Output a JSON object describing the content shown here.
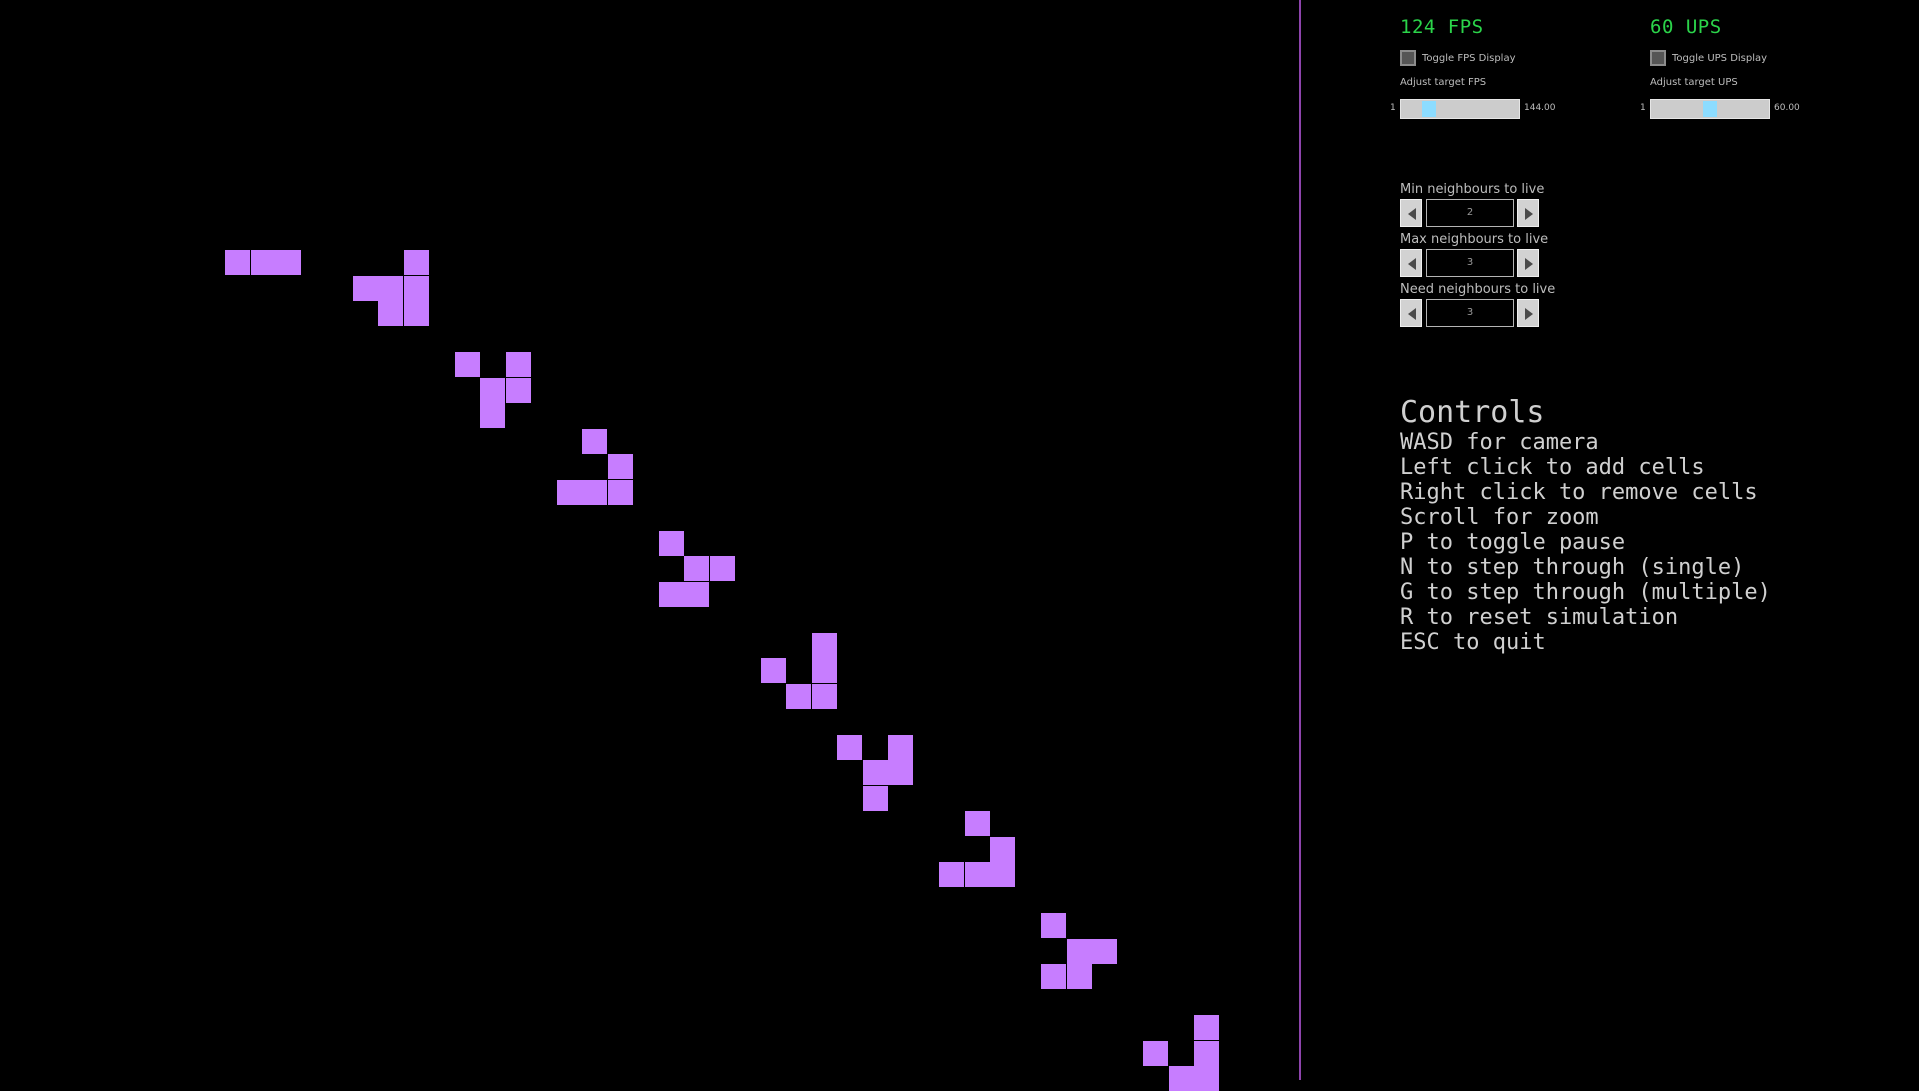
{
  "colors": {
    "background": "#000000",
    "cell": "#c77dff",
    "divider": "#8e44ad",
    "perf_text": "#2bd44a",
    "slider_handle": "#8cdcff"
  },
  "simulation": {
    "cells": [
      [
        0,
        0
      ],
      [
        1,
        0
      ],
      [
        2,
        0
      ],
      [
        7,
        0
      ],
      [
        5,
        1
      ],
      [
        6,
        1
      ],
      [
        7,
        1
      ],
      [
        6,
        2
      ],
      [
        7,
        2
      ],
      [
        9,
        4
      ],
      [
        11,
        4
      ],
      [
        10,
        5
      ],
      [
        11,
        5
      ],
      [
        10,
        6
      ],
      [
        14,
        7
      ],
      [
        15,
        8
      ],
      [
        13,
        9
      ],
      [
        14,
        9
      ],
      [
        15,
        9
      ],
      [
        17,
        11
      ],
      [
        18,
        12
      ],
      [
        19,
        12
      ],
      [
        17,
        13
      ],
      [
        18,
        13
      ],
      [
        23,
        15
      ],
      [
        21,
        16
      ],
      [
        23,
        16
      ],
      [
        22,
        17
      ],
      [
        23,
        17
      ],
      [
        24,
        19
      ],
      [
        26,
        19
      ],
      [
        25,
        20
      ],
      [
        26,
        20
      ],
      [
        25,
        21
      ],
      [
        29,
        22
      ],
      [
        30,
        23
      ],
      [
        28,
        24
      ],
      [
        29,
        24
      ],
      [
        30,
        24
      ],
      [
        32,
        26
      ],
      [
        33,
        27
      ],
      [
        34,
        27
      ],
      [
        32,
        28
      ],
      [
        33,
        28
      ],
      [
        38,
        30
      ],
      [
        36,
        31
      ],
      [
        38,
        31
      ],
      [
        37,
        32
      ],
      [
        38,
        32
      ]
    ]
  },
  "panel": {
    "fps": {
      "readout": "124 FPS",
      "toggle_label": "Toggle FPS Display",
      "adjust_label": "Adjust target FPS",
      "slider_min": "1",
      "slider_max": "144.00",
      "slider_fraction": 0.2
    },
    "ups": {
      "readout": "60 UPS",
      "toggle_label": "Toggle UPS Display",
      "adjust_label": "Adjust target UPS",
      "slider_min": "1",
      "slider_max": "60.00",
      "slider_fraction": 0.5
    },
    "spinners": [
      {
        "label": "Min neighbours to live",
        "value": "2"
      },
      {
        "label": "Max neighbours to live",
        "value": "3"
      },
      {
        "label": "Need neighbours to live",
        "value": "3"
      }
    ],
    "controls": {
      "title": "Controls",
      "lines": [
        "WASD for camera",
        "Left click to add cells",
        "Right click to remove cells",
        "Scroll for zoom",
        "P to toggle pause",
        "N to step through (single)",
        "G to step through (multiple)",
        "R to reset simulation",
        "ESC to quit"
      ]
    }
  }
}
